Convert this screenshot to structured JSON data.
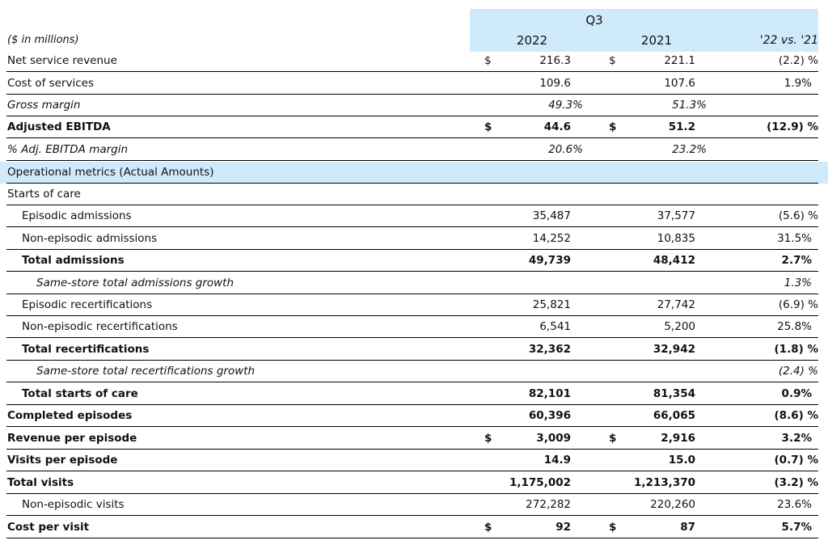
{
  "header": {
    "period": "Q3",
    "units": "($ in millions)",
    "col_2022": "2022",
    "col_2021": "2021",
    "col_change": "'22 vs. '21"
  },
  "section_title": "Operational metrics (Actual Amounts)",
  "rows": [
    {
      "label": "Net service revenue",
      "cur1": "$",
      "v2022": "216.3",
      "cur2": "$",
      "v2021": "221.1",
      "change": "(2.2) %"
    },
    {
      "label": "Cost of services",
      "v2022": "109.6",
      "v2021": "107.6",
      "change": "1.9%"
    },
    {
      "label": "Gross margin",
      "v2022": "49.3%",
      "v2021": "51.3%",
      "change": ""
    },
    {
      "label": "Adjusted EBITDA",
      "cur1": "$",
      "v2022": "44.6",
      "cur2": "$",
      "v2021": "51.2",
      "change": "(12.9) %"
    },
    {
      "label": "% Adj. EBITDA margin",
      "v2022": "20.6%",
      "v2021": "23.2%",
      "change": ""
    },
    {
      "label": "Starts of care"
    },
    {
      "label": "Episodic admissions",
      "v2022": "35,487",
      "v2021": "37,577",
      "change": "(5.6) %"
    },
    {
      "label": "Non-episodic admissions",
      "v2022": "14,252",
      "v2021": "10,835",
      "change": "31.5%"
    },
    {
      "label": "Total admissions",
      "v2022": "49,739",
      "v2021": "48,412",
      "change": "2.7%"
    },
    {
      "label": "Same-store total admissions growth",
      "change": "1.3%"
    },
    {
      "label": "Episodic recertifications",
      "v2022": "25,821",
      "v2021": "27,742",
      "change": "(6.9) %"
    },
    {
      "label": "Non-episodic recertifications",
      "v2022": "6,541",
      "v2021": "5,200",
      "change": "25.8%"
    },
    {
      "label": "Total recertifications",
      "v2022": "32,362",
      "v2021": "32,942",
      "change": "(1.8) %"
    },
    {
      "label": "Same-store total recertifications growth",
      "change": "(2.4) %"
    },
    {
      "label": "Total starts of care",
      "v2022": "82,101",
      "v2021": "81,354",
      "change": "0.9%"
    },
    {
      "label": "Completed episodes",
      "v2022": "60,396",
      "v2021": "66,065",
      "change": "(8.6) %"
    },
    {
      "label": "Revenue per episode",
      "cur1": "$",
      "v2022": "3,009",
      "cur2": "$",
      "v2021": "2,916",
      "change": "3.2%"
    },
    {
      "label": "Visits per episode",
      "v2022": "14.9",
      "v2021": "15.0",
      "change": "(0.7) %"
    },
    {
      "label": "Total visits",
      "v2022": "1,175,002",
      "v2021": "1,213,370",
      "change": "(3.2) %"
    },
    {
      "label": "Non-episodic visits",
      "v2022": "272,282",
      "v2021": "220,260",
      "change": "23.6%"
    },
    {
      "label": "Cost per visit",
      "cur1": "$",
      "v2022": "92",
      "cur2": "$",
      "v2021": "87",
      "change": "5.7%"
    }
  ]
}
